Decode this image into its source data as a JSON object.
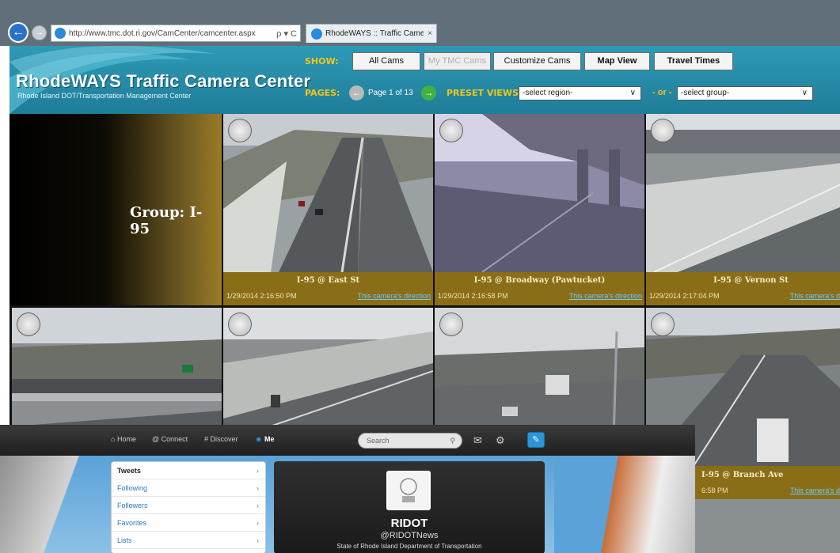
{
  "browser": {
    "url": "http://www.tmc.dot.ri.gov/CamCenter/camcenter.aspx",
    "address_tools": "ρ ▾ C",
    "tab_title": "RhodeWAYS :: Traffic Came...",
    "tab_close": "×",
    "back_glyph": "←",
    "forward_glyph": "→"
  },
  "site": {
    "title": "RhodeWAYS Traffic Camera Center",
    "subtitle": "Rhode Island DOT/Transportation Management Center",
    "show_label": "SHOW:",
    "pages_label": "PAGES:",
    "preset_label": "PRESET VIEWS:",
    "or_text": "- or -",
    "buttons": {
      "all_cams": "All Cams",
      "my_tmc_cams": "My TMC Cams",
      "customize_cams": "Customize Cams",
      "map_view": "Map View",
      "travel_times": "Travel Times"
    },
    "page_indicator": "Page 1 of 13",
    "prev_glyph": "←",
    "next_glyph": "→",
    "region_select": "-select region-",
    "group_select": "-select group-",
    "chevron": "∨"
  },
  "group_label": "Group: I-95",
  "cameras": [
    {
      "title": "I-95 @ East St",
      "time": "1/29/2014 2:16:50 PM",
      "direction_link": "This camera's direction"
    },
    {
      "title": "I-95 @ Broadway (Pawtucket)",
      "time": "1/29/2014 2:16:58 PM",
      "direction_link": "This camera's direction"
    },
    {
      "title": "I-95 @ Vernon St",
      "time": "1/29/2014 2:17:04 PM",
      "direction_link": "This camera's direct"
    },
    {
      "title": "",
      "time": "",
      "direction_link": ""
    },
    {
      "title": "",
      "time": "",
      "direction_link": ""
    },
    {
      "title": "",
      "time": "",
      "direction_link": ""
    },
    {
      "title": "I-95 @ Branch Ave",
      "time": "6:58 PM",
      "direction_link": "This camera's direct"
    }
  ],
  "twitter": {
    "nav": {
      "home": "Home",
      "connect": "Connect",
      "discover": "Discover",
      "me": "Me"
    },
    "search_placeholder": "Search",
    "menu": [
      {
        "label": "Tweets",
        "active": true
      },
      {
        "label": "Following",
        "active": false
      },
      {
        "label": "Followers",
        "active": false
      },
      {
        "label": "Favorites",
        "active": false
      },
      {
        "label": "Lists",
        "active": false
      }
    ],
    "profile": {
      "name": "RIDOT",
      "handle": "@RIDOTNews",
      "description": "State of Rhode Island Department of Transportation"
    },
    "icons": {
      "home": "⌂",
      "connect": "@",
      "discover": "#",
      "me": "☻",
      "search": "⚲",
      "mail": "✉",
      "gear": "⚙",
      "compose": "✎",
      "arrow": "›"
    }
  },
  "colors": {
    "header": "#2e9ab6",
    "label_yellow": "#f2c418",
    "caption_bar": "#8a6e17",
    "link_blue": "#6fc8ff",
    "twitter_bar": "#2a2a2a",
    "twitter_blue": "#2a96d8"
  }
}
